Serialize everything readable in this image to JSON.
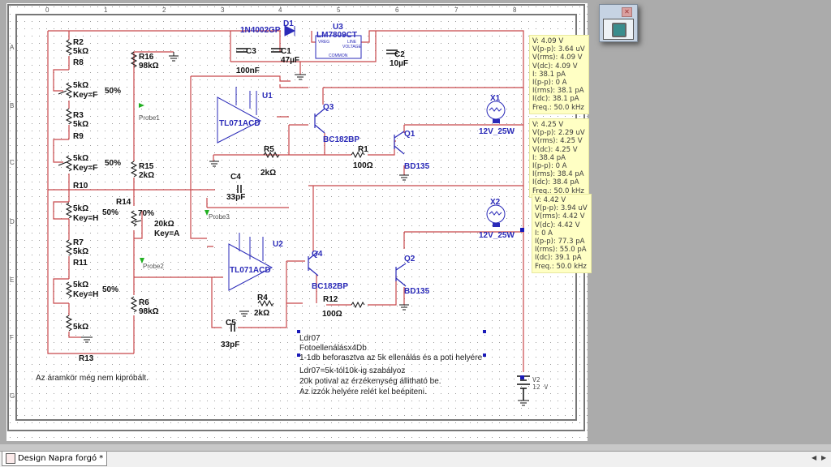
{
  "sheet": {
    "columns": [
      "0",
      "1",
      "2",
      "3",
      "4",
      "5",
      "6",
      "7",
      "8"
    ],
    "rows": [
      "A",
      "B",
      "C",
      "D",
      "E",
      "F",
      "G"
    ]
  },
  "labels": {
    "R2": "R2",
    "R2v": "5kΩ",
    "R8": "R8",
    "R8v": "5kΩ",
    "R8k": "Key=F",
    "R8p": "50%",
    "R3": "R3",
    "R3v": "5kΩ",
    "R9": "R9",
    "R9v": "5kΩ",
    "R9k": "Key=F",
    "R9p": "50%",
    "R10": "R10",
    "R10v": "5kΩ",
    "R10k": "Key=H",
    "R10p": "50%",
    "R7": "R7",
    "R7v": "5kΩ",
    "R11": "R11",
    "R11v": "5kΩ",
    "R11k": "Key=H",
    "R11p": "50%",
    "R13v": "5kΩ",
    "R13": "R13",
    "R16": "R16",
    "R16v": "98kΩ",
    "R15": "R15",
    "R15v": "2kΩ",
    "R14": "R14",
    "R14p": "70%",
    "R14v": "20kΩ",
    "R14k": "Key=A",
    "R6": "R6",
    "R6v": "98kΩ",
    "probe1": "Probe1",
    "probe2": "Probe2",
    "probe3": "Probe3",
    "D1": "D1",
    "D1v": "1N4002GP",
    "U3": "U3",
    "U3v": "LM7809CT",
    "U3in": "VREG",
    "U3line": "LINE",
    "U3volt": "VOLTAGE",
    "U3com": "COMMON",
    "C3": "C3",
    "C3v": "100nF",
    "C1": "C1",
    "C1v": "47µF",
    "C2": "C2",
    "C2v": "10µF",
    "U1": "U1",
    "U1v": "TL071ACD",
    "U2": "U2",
    "U2v": "TL071ACD",
    "Q3": "Q3",
    "Q3v": "BC182BP",
    "Q4": "Q4",
    "Q4v": "BC182BP",
    "Q1": "Q1",
    "Q1v": "BD135",
    "Q2": "Q2",
    "Q2v": "BD135",
    "R5": "R5",
    "R5v": "2kΩ",
    "R1": "R1",
    "R1v": "100Ω",
    "R4": "R4",
    "R4v": "2kΩ",
    "R12": "R12",
    "R12v": "100Ω",
    "C4": "C4",
    "C4v": "33pF",
    "C5": "C5",
    "C5v": "33pF",
    "X1": "X1",
    "X1v": "12V_25W",
    "X2": "X2",
    "X2v": "12V_25W",
    "V2": "V2",
    "V2v": "12 V"
  },
  "notes": {
    "left": "Az áramkör még nem kipróbált.",
    "lines": [
      "Ldr07",
      "Fotoellenálásx4Db",
      "1-1db beforasztva az 5k ellenálás és a poti helyére",
      "Ldr07=5k-tól10k-ig szabályoz",
      "20k potival az érzékenység állitható be.",
      "Az izzók helyére relét kel beépiteni."
    ]
  },
  "probes": [
    {
      "lines": [
        "V: 4.09 V",
        "V(p-p): 3.64 uV",
        "V(rms): 4.09 V",
        "V(dc): 4.09 V",
        "I: 38.1 pA",
        "I(p-p): 0 A",
        "I(rms): 38.1 pA",
        "I(dc): 38.1 pA",
        "Freq.: 50.0 kHz"
      ]
    },
    {
      "lines": [
        "V: 4.25 V",
        "V(p-p): 2.29 uV",
        "V(rms): 4.25 V",
        "V(dc): 4.25 V",
        "I: 38.4 pA",
        "I(p-p): 0 A",
        "I(rms): 38.4 pA",
        "I(dc): 38.4 pA",
        "Freq.: 50.0 kHz"
      ]
    },
    {
      "lines": [
        "V: 4.42 V",
        "V(p-p): 3.94 uV",
        "V(rms): 4.42 V",
        "V(dc): 4.42 V",
        "I: 0 A",
        "I(p-p): 77.3 pA",
        "I(rms): 55.0 pA",
        "I(dc): 39.1 pA",
        "Freq.: 50.0 kHz"
      ]
    }
  ],
  "tabs": [
    {
      "label": "Design Napra forgó *"
    }
  ],
  "colors": {
    "wire": "#c8474a",
    "component_label": "#2a2ab8",
    "probe_bg": "#ffffc4",
    "probe_arrow": "#22b022"
  }
}
